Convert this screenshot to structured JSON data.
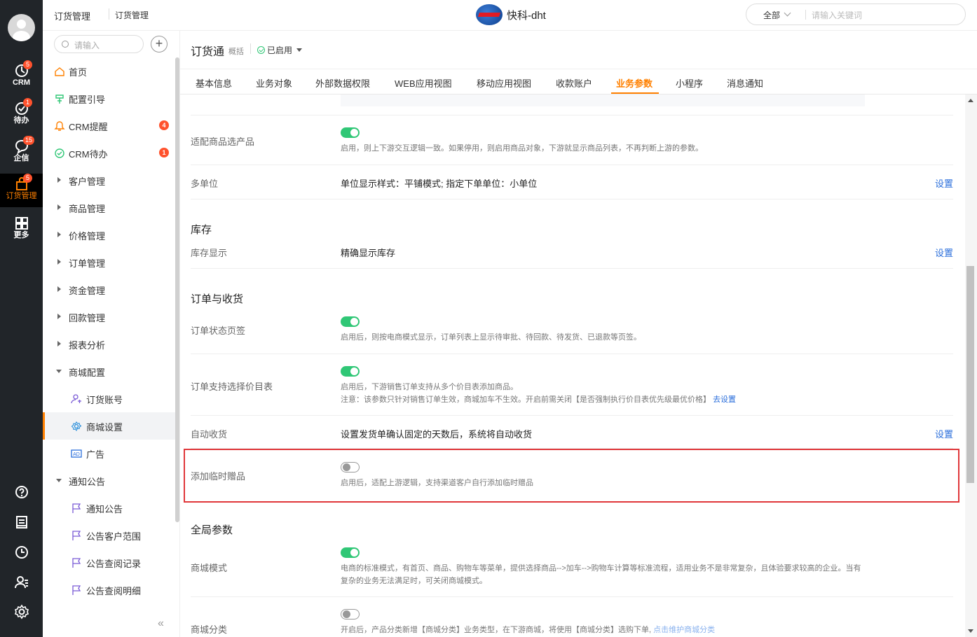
{
  "rail": {
    "items": [
      {
        "label": "CRM",
        "badge": "5",
        "icon": "crm-icon"
      },
      {
        "label": "待办",
        "badge": "1",
        "icon": "todo-icon"
      },
      {
        "label": "企信",
        "badge": "15",
        "icon": "chat-icon"
      },
      {
        "label": "订货管理",
        "badge": "5",
        "icon": "order-bag-icon"
      },
      {
        "label": "更多",
        "badge": "",
        "icon": "grid-icon"
      }
    ],
    "bottom_icons": [
      "help-icon",
      "notes-icon",
      "clock-icon",
      "contacts-icon",
      "settings-icon"
    ]
  },
  "topbar": {
    "crumb1": "订货管理",
    "crumb2": "订货管理",
    "logo_text": "快科-dht",
    "search_scope": "全部",
    "search_placeholder": "请输入关键词"
  },
  "sidebar": {
    "search_placeholder": "请输入",
    "add_label": "+",
    "collapse_label": "«",
    "items": [
      {
        "label": "首页",
        "kind": "link",
        "icon": "home-icon"
      },
      {
        "label": "配置引导",
        "kind": "link",
        "icon": "guide-icon"
      },
      {
        "label": "CRM提醒",
        "kind": "link",
        "icon": "bell-icon",
        "badge": "4"
      },
      {
        "label": "CRM待办",
        "kind": "link",
        "icon": "check-circle-icon",
        "badge": "1"
      },
      {
        "label": "客户管理",
        "kind": "group"
      },
      {
        "label": "商品管理",
        "kind": "group"
      },
      {
        "label": "价格管理",
        "kind": "group"
      },
      {
        "label": "订单管理",
        "kind": "group"
      },
      {
        "label": "资金管理",
        "kind": "group"
      },
      {
        "label": "回款管理",
        "kind": "group"
      },
      {
        "label": "报表分析",
        "kind": "group"
      },
      {
        "label": "商城配置",
        "kind": "group-open"
      },
      {
        "label": "订货账号",
        "kind": "sub",
        "icon": "account-icon"
      },
      {
        "label": "商城设置",
        "kind": "sub",
        "icon": "gear-icon",
        "active": true
      },
      {
        "label": "广告",
        "kind": "sub",
        "icon": "ad-icon"
      },
      {
        "label": "通知公告",
        "kind": "group-open"
      },
      {
        "label": "通知公告",
        "kind": "sub",
        "icon": "flag-icon"
      },
      {
        "label": "公告客户范围",
        "kind": "sub",
        "icon": "flag-icon"
      },
      {
        "label": "公告查阅记录",
        "kind": "sub",
        "icon": "flag-icon"
      },
      {
        "label": "公告查阅明细",
        "kind": "sub",
        "icon": "flag-icon"
      }
    ]
  },
  "header": {
    "title": "订货通",
    "subtitle": "概括",
    "status": "已启用"
  },
  "tabs": [
    "基本信息",
    "业务对象",
    "外部数据权限",
    "WEB应用视图",
    "移动应用视图",
    "收款账户",
    "业务参数",
    "小程序",
    "消息通知"
  ],
  "active_tab": "业务参数",
  "settings": {
    "adapt_product": {
      "label": "适配商品选产品",
      "enabled": true,
      "desc": "启用，则上下游交互逻辑一致。如果停用，则启用商品对象，下游就显示商品列表，不再判断上游的参数。"
    },
    "multi_unit": {
      "label": "多单位",
      "value": "单位显示样式：平铺模式;  指定下单单位：小单位",
      "link": "设置"
    },
    "inventory_section": "库存",
    "inventory_display": {
      "label": "库存显示",
      "value": "精确显示库存",
      "link": "设置"
    },
    "order_section": "订单与收货",
    "order_status_tabs": {
      "label": "订单状态页签",
      "enabled": true,
      "desc": "启用后，则按电商模式显示，订单列表上显示待审批、待回款、待发货、已退款等页签。"
    },
    "order_price_list": {
      "label": "订单支持选择价目表",
      "enabled": true,
      "desc1": "启用后，下游销售订单支持从多个价目表添加商品。",
      "desc2": "注意：该参数只针对销售订单生效，商城加车不生效。开启前需关闭【是否强制执行价目表优先级最优价格】",
      "desc2_link": "去设置"
    },
    "auto_receive": {
      "label": "自动收货",
      "value": "设置发货单确认固定的天数后，系统将自动收货",
      "link": "设置"
    },
    "temp_gift": {
      "label": "添加临时赠品",
      "enabled": false,
      "desc": "启用后，适配上游逻辑，支持渠道客户自行添加临时赠品"
    },
    "global_section": "全局参数",
    "mall_mode": {
      "label": "商城模式",
      "enabled": true,
      "desc1": "电商的标准模式，有首页、商品、购物车等菜单，提供选择商品-->加车-->购物车计算等标准流程，适用业务不是非常复杂，且体验要求较高的企业。当有",
      "desc2": "复杂的业务无法满足时，可关闭商城模式。"
    },
    "mall_category": {
      "label": "商城分类",
      "enabled": false,
      "desc": "开启后，产品分类新增【商城分类】业务类型，在下游商城，将使用【商城分类】选购下单, ",
      "desc_link": "点击维护商城分类"
    }
  },
  "colors": {
    "accent": "#ff8000",
    "toggle_on": "#30c776",
    "link": "#2a6edb",
    "highlight": "#e0373a",
    "rail_bg": "#212529"
  }
}
